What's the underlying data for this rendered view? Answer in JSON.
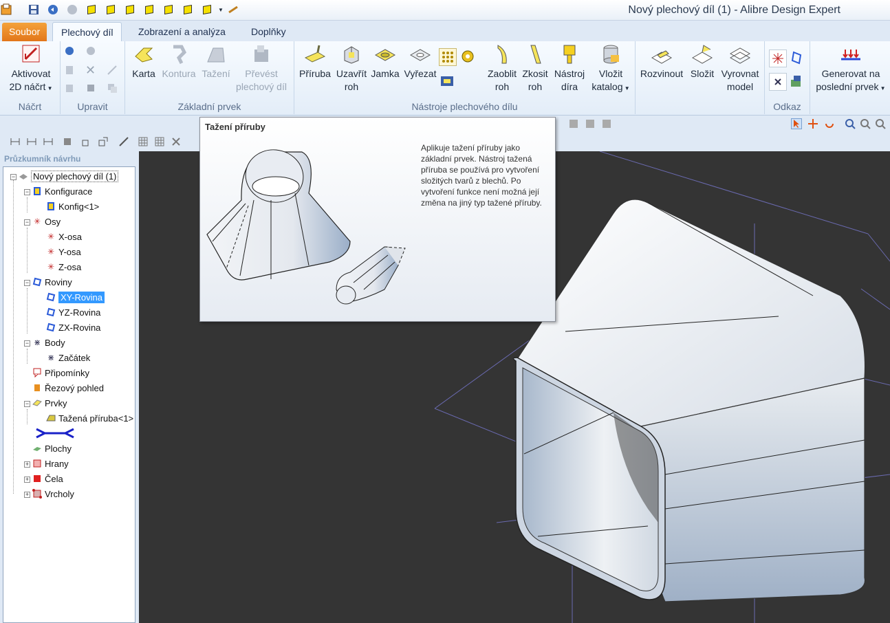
{
  "window": {
    "title": "Nový plechový díl (1) - Alibre Design Expert"
  },
  "tabs": [
    {
      "label": "Soubor"
    },
    {
      "label": "Plechový díl"
    },
    {
      "label": "Zobrazení a analýza"
    },
    {
      "label": "Doplňky"
    }
  ],
  "ribbon": {
    "groups": {
      "nacrt": "Náčrt",
      "upravit": "Upravit",
      "zakladni": "Základní prvek",
      "nastroje": "Nástroje plechového dílu",
      "odkaz": "Odkaz"
    },
    "buttons": {
      "aktivovat_1": "Aktivovat",
      "aktivovat_2": "2D náčrt",
      "karta": "Karta",
      "kontura": "Kontura",
      "tazeni": "Tažení",
      "prevest_1": "Převést",
      "prevest_2": "plechový díl",
      "priruba": "Příruba",
      "uzavrit_1": "Uzavřít",
      "uzavrit_2": "roh",
      "jamka": "Jamka",
      "vyrezat": "Vyřezat",
      "zaoblit_1": "Zaoblit",
      "zaoblit_2": "roh",
      "zkosit_1": "Zkosit",
      "zkosit_2": "roh",
      "nastroj_1": "Nástroj",
      "nastroj_2": "díra",
      "vlozit_1": "Vložit",
      "vlozit_2": "katalog",
      "rozvinout": "Rozvinout",
      "slozit": "Složit",
      "vyrovnat_1": "Vyrovnat",
      "vyrovnat_2": "model",
      "generovat_1": "Generovat na",
      "generovat_2": "poslední prvek"
    }
  },
  "explorer": {
    "title": "Průzkumník návrhu",
    "nodes": {
      "root": "Nový plechový díl (1)",
      "konfigurace": "Konfigurace",
      "konfig1": "Konfig<1>",
      "osy": "Osy",
      "xosa": "X-osa",
      "yosa": "Y-osa",
      "zosa": "Z-osa",
      "roviny": "Roviny",
      "xy": "XY-Rovina",
      "yz": "YZ-Rovina",
      "zx": "ZX-Rovina",
      "body": "Body",
      "zacatek": "Začátek",
      "pripominky": "Připomínky",
      "rezovy": "Řezový pohled",
      "prvky": "Prvky",
      "tazena": "Tažená příruba<1>",
      "plochy": "Plochy",
      "hrany": "Hrany",
      "cela": "Čela",
      "vrcholy": "Vrcholy"
    }
  },
  "tooltip": {
    "title": "Tažení příruby",
    "body": "Aplikuje tažení příruby jako základní prvek. Nástroj tažená příruba se používá pro vytvoření složitých tvarů z blechů. Po vytvoření funkce není možná její změna na jiný typ tažené příruby."
  },
  "colors": {
    "file_tab": "#e2761a",
    "selection": "#3399ff",
    "viewport_bg": "#343434",
    "model_face": "#b8c6d8"
  }
}
